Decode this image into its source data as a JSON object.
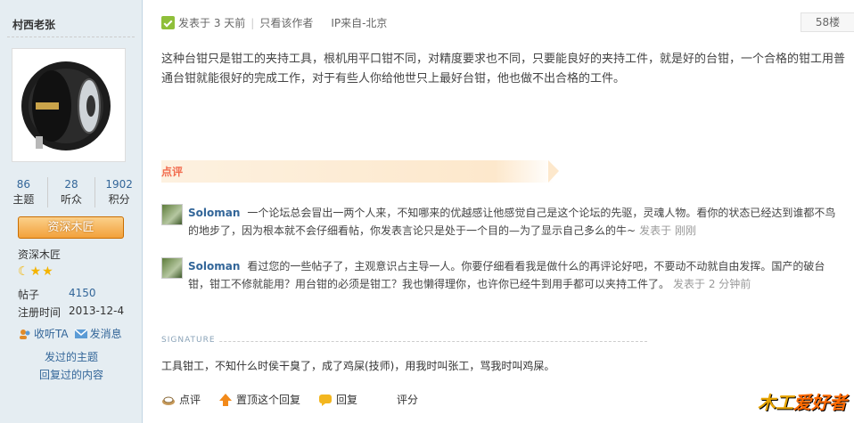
{
  "author": {
    "name": "村西老张",
    "stats": [
      {
        "num": "86",
        "label": "主题"
      },
      {
        "num": "28",
        "label": "听众"
      },
      {
        "num": "1902",
        "label": "积分"
      }
    ],
    "rank_button": "资深木匠",
    "rank_name": "资深木匠",
    "info": [
      {
        "key": "帖子",
        "value": "4150"
      },
      {
        "key": "注册时间",
        "value": "2013-12-4"
      }
    ],
    "actions": {
      "follow": "收听TA",
      "message": "发消息"
    },
    "links": [
      "发过的主题",
      "回复过的内容"
    ]
  },
  "post": {
    "meta": {
      "posted": "发表于 3 天前",
      "only_author": "只看该作者",
      "ip": "IP来自-北京"
    },
    "floor": "58楼",
    "content": "这种台钳只是钳工的夹持工具，根机用平口钳不同，对精度要求也不同，只要能良好的夹持工件，就是好的台钳，一个合格的钳工用普通台钳就能很好的完成工作，对于有些人你给他世只上最好台钳，他也做不出合格的工件。",
    "review_title": "点评",
    "comments": [
      {
        "user": "Soloman",
        "text": "一个论坛总会冒出一两个人来，不知哪来的优越感让他感觉自己是这个论坛的先驱，灵魂人物。看你的状态已经达到谁都不鸟的地步了，因为根本就不会仔细看帖，你发表言论只是处于一个目的—为了显示自己多么的牛~",
        "time": "发表于 刚刚"
      },
      {
        "user": "Soloman",
        "text": "看过您的一些帖子了，主观意识占主导一人。你要仔细看看我是做什么的再评论好吧，不要动不动就自由发挥。国产的破台钳，钳工不修就能用？用台钳的必须是钳工？我也懒得理你，也许你已经牛到用手都可以夹持工件了。",
        "time": "发表于 2 分钟前"
      }
    ],
    "signature_label": "SIGNATURE",
    "signature": "工具钳工，不知什么时侯干臭了，成了鸡屎(技师)，用我时叫张工，骂我时叫鸡屎。",
    "footer": {
      "review": "点评",
      "top": "置顶这个回复",
      "reply": "回复",
      "rate": "评分"
    },
    "logo": {
      "part1": "木工",
      "part2": "爱好者"
    }
  },
  "colors": {
    "link": "#336699",
    "sidebar": "#e5edf2",
    "review": "#f26c4f"
  }
}
